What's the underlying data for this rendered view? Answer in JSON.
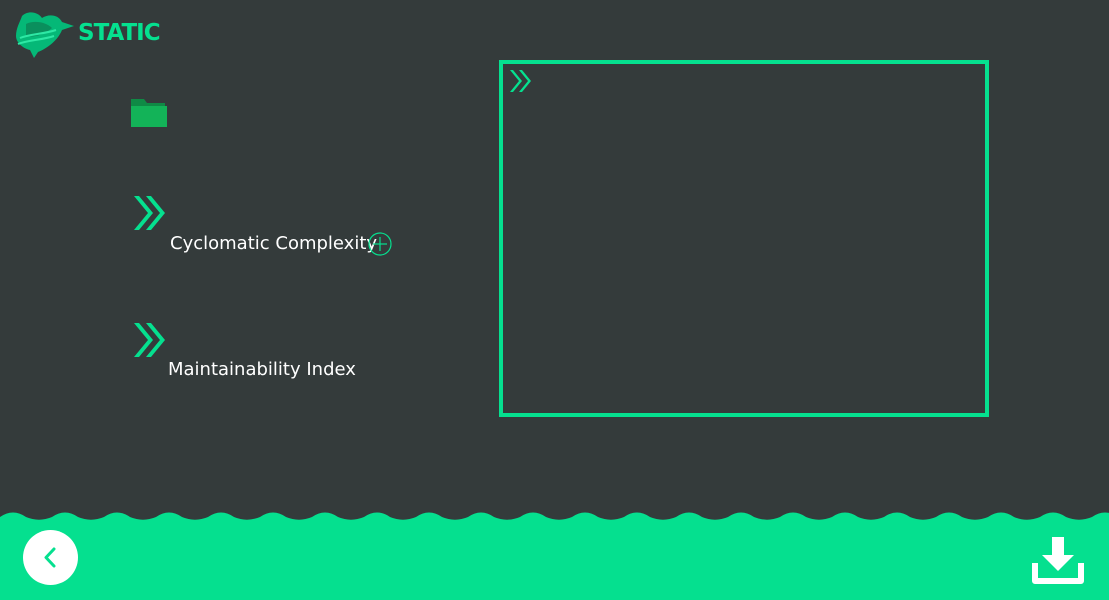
{
  "app": {
    "logo_text": "STATIC"
  },
  "colors": {
    "background": "#343b3b",
    "accent": "#05e08f",
    "text": "#ffffff"
  },
  "metrics": [
    {
      "label": "Cyclomatic Complexity",
      "icon": "double-chevron-right-icon",
      "action_icon": "plus-circle-icon"
    },
    {
      "label": "Maintainability Index",
      "icon": "double-chevron-right-icon"
    }
  ],
  "actions": {
    "open_folder_icon": "folder-icon",
    "back_icon": "chevron-left-icon",
    "download_icon": "download-icon"
  }
}
